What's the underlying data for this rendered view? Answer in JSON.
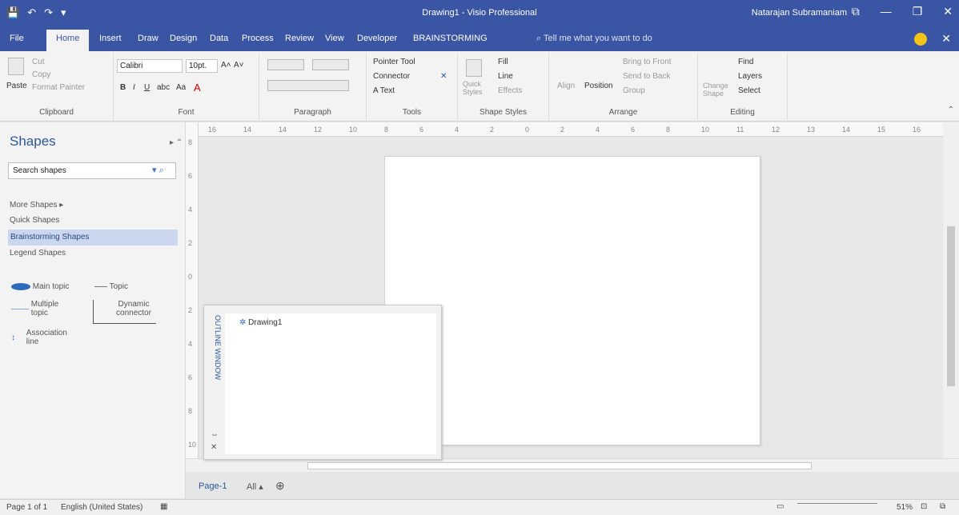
{
  "titlebar": {
    "quick_access": [
      "💾",
      "↶",
      "↷",
      "▾"
    ],
    "title": "Drawing1 - Visio Professional",
    "user": "Natarajan Subramaniam",
    "controls": [
      "⧉",
      "—",
      "❐",
      "✕"
    ]
  },
  "tabs": [
    "File",
    "Home",
    "Insert",
    "Draw",
    "Design",
    "Data",
    "Process",
    "Review",
    "View",
    "Developer",
    "BRAINSTORMING"
  ],
  "tell_me": "⌕ Tell me what you want to do",
  "ribbon": {
    "clipboard": {
      "paste": "Paste",
      "cut": "Cut",
      "copy": "Copy",
      "format_painter": "Format Painter",
      "label": "Clipboard"
    },
    "font": {
      "name": "Calibri",
      "size": "10pt.",
      "grow": "A˄",
      "shrink": "A˅",
      "bold": "B",
      "italic": "I",
      "underline": "U",
      "strike": "abc",
      "case": "Aa",
      "color": "A",
      "label": "Font"
    },
    "paragraph": {
      "label": "Paragraph"
    },
    "tools": {
      "pointer": "Pointer Tool",
      "connector": "Connector",
      "text": "A Text",
      "label": "Tools"
    },
    "shape_styles": {
      "quick_styles": "Quick Styles",
      "fill": "Fill",
      "line": "Line",
      "effects": "Effects",
      "label": "Shape Styles"
    },
    "arrange": {
      "align": "Align",
      "position": "Position",
      "bring_front": "Bring to Front",
      "send_back": "Send to Back",
      "group": "Group",
      "label": "Arrange"
    },
    "editing": {
      "change_shape": "Change Shape",
      "find": "Find",
      "layers": "Layers",
      "select": "Select",
      "label": "Editing"
    }
  },
  "shapes_pane": {
    "heading": "Shapes",
    "search_value": "Search shapes",
    "stencils": [
      "More Shapes ▸",
      "Quick Shapes",
      "Brainstorming Shapes",
      "Legend Shapes"
    ],
    "selected_stencil": "Brainstorming Shapes",
    "items": [
      "Main topic",
      "Topic",
      "Multiple topic",
      "Dynamic connector",
      "Association line"
    ]
  },
  "ruler_h": [
    "16",
    "14",
    "14",
    "12",
    "10",
    "8",
    "6",
    "4",
    "2",
    "0",
    "2",
    "4",
    "6",
    "8",
    "10",
    "11",
    "12",
    "13",
    "14",
    "15",
    "16"
  ],
  "ruler_v": [
    "8",
    "6",
    "4",
    "2",
    "0",
    "2",
    "4",
    "6",
    "8",
    "10"
  ],
  "outline": {
    "title": "OUTLINE WINDOW",
    "root": "Drawing1"
  },
  "page_tabs": {
    "page": "Page-1",
    "all": "All ▴",
    "add": "⊕"
  },
  "status": {
    "page": "Page 1 of 1",
    "language": "English (United States)",
    "zoom": "51%"
  }
}
